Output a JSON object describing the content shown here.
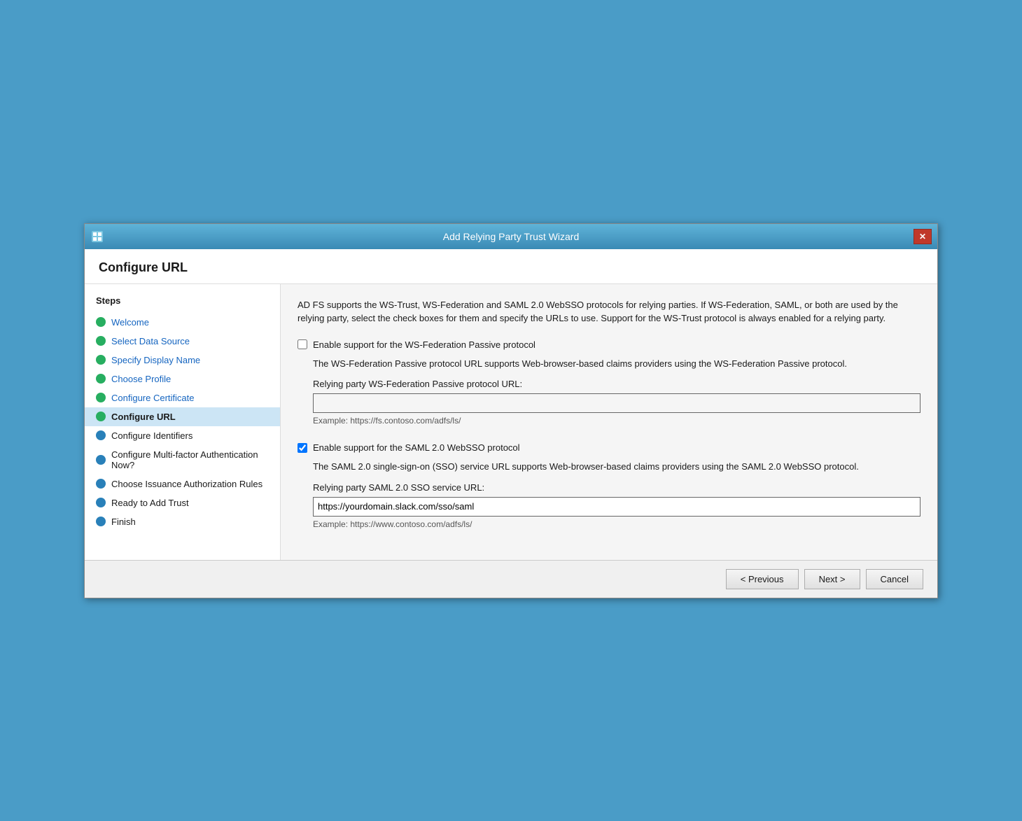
{
  "window": {
    "title": "Add Relying Party Trust Wizard",
    "close_label": "✕"
  },
  "page": {
    "title": "Configure URL"
  },
  "sidebar": {
    "steps_label": "Steps",
    "items": [
      {
        "id": "welcome",
        "label": "Welcome",
        "dot": "green",
        "active": false,
        "link": true
      },
      {
        "id": "select-data-source",
        "label": "Select Data Source",
        "dot": "green",
        "active": false,
        "link": true
      },
      {
        "id": "specify-display-name",
        "label": "Specify Display Name",
        "dot": "green",
        "active": false,
        "link": true
      },
      {
        "id": "choose-profile",
        "label": "Choose Profile",
        "dot": "green",
        "active": false,
        "link": true
      },
      {
        "id": "configure-certificate",
        "label": "Configure Certificate",
        "dot": "green",
        "active": false,
        "link": true
      },
      {
        "id": "configure-url",
        "label": "Configure URL",
        "dot": "green",
        "active": true,
        "link": false
      },
      {
        "id": "configure-identifiers",
        "label": "Configure Identifiers",
        "dot": "blue",
        "active": false,
        "link": false
      },
      {
        "id": "configure-multifactor",
        "label": "Configure Multi-factor Authentication Now?",
        "dot": "blue",
        "active": false,
        "link": false
      },
      {
        "id": "choose-issuance",
        "label": "Choose Issuance Authorization Rules",
        "dot": "blue",
        "active": false,
        "link": false
      },
      {
        "id": "ready-to-add",
        "label": "Ready to Add Trust",
        "dot": "blue",
        "active": false,
        "link": false
      },
      {
        "id": "finish",
        "label": "Finish",
        "dot": "blue",
        "active": false,
        "link": false
      }
    ]
  },
  "main": {
    "description": "AD FS supports the WS-Trust, WS-Federation and SAML 2.0 WebSSO protocols for relying parties.  If WS-Federation, SAML, or both are used by the relying party, select the check boxes for them and specify the URLs to use.  Support for the WS-Trust protocol is always enabled for a relying party.",
    "ws_federation": {
      "checkbox_label": "Enable support for the WS-Federation Passive protocol",
      "checked": false,
      "description": "The WS-Federation Passive protocol URL supports Web-browser-based claims providers using the WS-Federation Passive protocol.",
      "field_label": "Relying party WS-Federation Passive protocol URL:",
      "field_value": "",
      "example": "Example: https://fs.contoso.com/adfs/ls/"
    },
    "saml": {
      "checkbox_label": "Enable support for the SAML 2.0 WebSSO protocol",
      "checked": true,
      "description": "The SAML 2.0 single-sign-on (SSO) service URL supports Web-browser-based claims providers using the SAML 2.0 WebSSO protocol.",
      "field_label": "Relying party SAML 2.0 SSO service URL:",
      "field_value": "https://yourdomain.slack.com/sso/saml",
      "example": "Example: https://www.contoso.com/adfs/ls/"
    }
  },
  "footer": {
    "previous_label": "< Previous",
    "next_label": "Next >",
    "cancel_label": "Cancel"
  }
}
